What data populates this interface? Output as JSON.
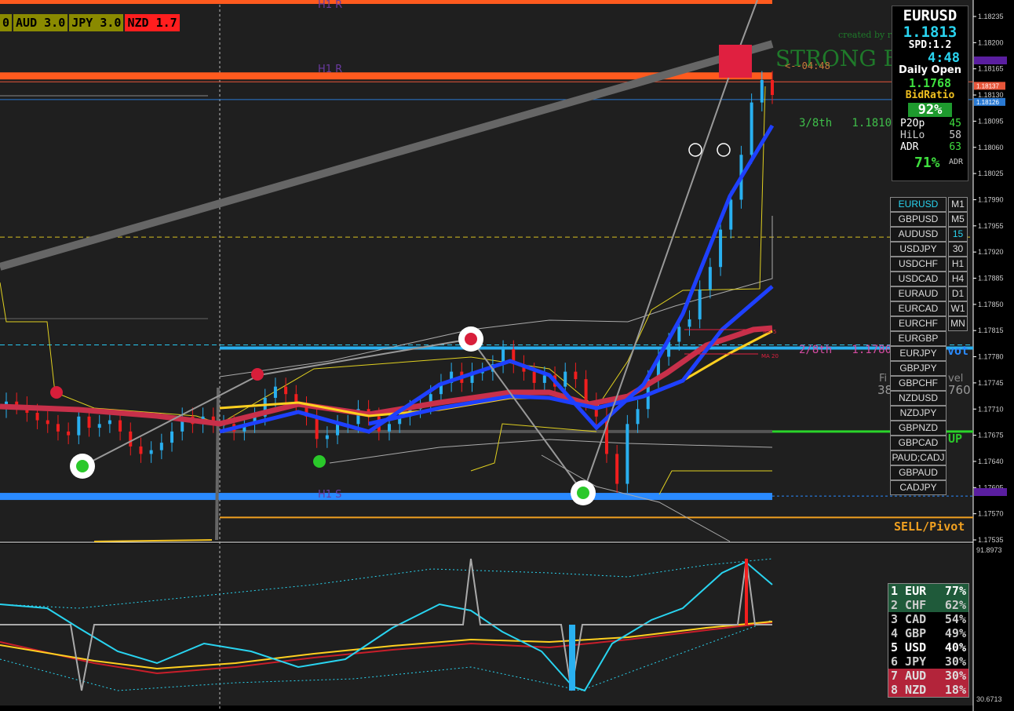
{
  "strength_bar": [
    {
      "label": "0",
      "bg": "#8a8a00",
      "fg": "#000"
    },
    {
      "label": "AUD 3.0",
      "bg": "#8a8a00",
      "fg": "#000"
    },
    {
      "label": "JPY 3.0",
      "bg": "#8a8a00",
      "fg": "#000"
    },
    {
      "label": "NZD 1.7",
      "bg": "#ff1e1e",
      "fg": "#000"
    }
  ],
  "info_panel": {
    "symbol": "EURUSD",
    "price": "1.1813",
    "spread": "SPD:1.2",
    "timer": "4:48",
    "daily_open_label": "Daily Open",
    "daily_open": "1.1768",
    "bid_ratio_label": "BidRatio",
    "bid_ratio": "92%",
    "p2op_label": "P2Op",
    "p2op": "45",
    "hilo_label": "HiLo",
    "hilo": "58",
    "adr_label": "ADR",
    "adr": "63",
    "adr_pct": "71%",
    "adr_pct_label": "ADR"
  },
  "symbols": [
    {
      "sym": "EURUSD",
      "tf": "M1",
      "active": true
    },
    {
      "sym": "GBPUSD",
      "tf": "M5"
    },
    {
      "sym": "AUDUSD",
      "tf": "15",
      "tf_active": true
    },
    {
      "sym": "USDJPY",
      "tf": "30"
    },
    {
      "sym": "USDCHF",
      "tf": "H1"
    },
    {
      "sym": "USDCAD",
      "tf": "H4"
    },
    {
      "sym": "EURAUD",
      "tf": "D1"
    },
    {
      "sym": "EURCAD",
      "tf": "W1"
    },
    {
      "sym": "EURCHF",
      "tf": "MN"
    },
    {
      "sym": "EURGBP",
      "tf": ""
    },
    {
      "sym": "EURJPY",
      "tf": ""
    },
    {
      "sym": "GBPJPY",
      "tf": ""
    },
    {
      "sym": "GBPCHF",
      "tf": ""
    },
    {
      "sym": "NZDUSD",
      "tf": ""
    },
    {
      "sym": "NZDJPY",
      "tf": ""
    },
    {
      "sym": "GBPNZD",
      "tf": ""
    },
    {
      "sym": "GBPCAD",
      "tf": ""
    },
    {
      "sym": "PAUD;CADJ",
      "tf": ""
    },
    {
      "sym": "GBPAUD",
      "tf": ""
    },
    {
      "sym": "CADJPY",
      "tf": ""
    }
  ],
  "ranking": [
    {
      "rank": "1",
      "cur": "EUR",
      "pct": "77%",
      "bg": "#1f5a3a",
      "fg": "#fff"
    },
    {
      "rank": "2",
      "cur": "CHF",
      "pct": "62%",
      "bg": "#1f5a3a",
      "fg": "#ccc"
    },
    {
      "rank": "3",
      "cur": "CAD",
      "pct": "54%",
      "bg": "#000",
      "fg": "#ccc"
    },
    {
      "rank": "4",
      "cur": "GBP",
      "pct": "49%",
      "bg": "#000",
      "fg": "#ccc"
    },
    {
      "rank": "5",
      "cur": "USD",
      "pct": "40%",
      "bg": "#000",
      "fg": "#fff"
    },
    {
      "rank": "6",
      "cur": "JPY",
      "pct": "30%",
      "bg": "#000",
      "fg": "#ccc"
    },
    {
      "rank": "7",
      "cur": "AUD",
      "pct": "30%",
      "bg": "#b3243a",
      "fg": "#ddd"
    },
    {
      "rank": "8",
      "cur": "NZD",
      "pct": "18%",
      "bg": "#b3243a",
      "fg": "#ddd"
    }
  ],
  "labels": {
    "strong": "STRONG B",
    "created_by": "created by re",
    "countdown": "<--04:48",
    "eighth_3": "3/8th   1.1810",
    "eighth_2": "2/8th   1.1780",
    "pivot_suffix": "vot",
    "sell_pivot": "SELL/Pivot",
    "up": "UP",
    "h1r": "H1 R",
    "h1s": "H1 S",
    "fib_a": "Fi",
    "fib_b": "vel",
    "fib_c": "38",
    "fib_d": "760",
    "ma5": "MA 5",
    "ma20": "MA 20"
  },
  "chart_data": {
    "type": "candlestick",
    "symbol": "EURUSD",
    "y_range": [
      1.17535,
      1.18235
    ],
    "price_axis_ticks": [
      "1.18235",
      "1.18200",
      "1.18165",
      "1.18130",
      "1.18095",
      "1.18060",
      "1.18025",
      "1.17990",
      "1.17955",
      "1.17920",
      "1.17885",
      "1.17850",
      "1.17815",
      "1.17780",
      "1.17745",
      "1.17710",
      "1.17675",
      "1.17640",
      "1.17605",
      "1.17570",
      "1.17535"
    ],
    "price_markers": [
      {
        "value": "1.18137",
        "color": "#e8563a"
      },
      {
        "value": "1.18126",
        "color": "#2a7ad4"
      }
    ],
    "levels": {
      "h1r": 1.18195,
      "daily_high": 1.18155,
      "eighth_3": 1.181,
      "eighth_2": 1.178,
      "daily_open": 1.1768,
      "h1s": 1.176,
      "sell_pivot": 1.17565
    },
    "closes": [
      1.1772,
      1.17715,
      1.17705,
      1.17695,
      1.1769,
      1.1768,
      1.17675,
      1.177,
      1.17685,
      1.1769,
      1.17695,
      1.1768,
      1.1766,
      1.1765,
      1.17655,
      1.17665,
      1.1768,
      1.177,
      1.1769,
      1.177,
      1.1769,
      1.1769,
      1.1768,
      1.1769,
      1.177,
      1.17725,
      1.1774,
      1.1773,
      1.17715,
      1.177,
      1.1767,
      1.17675,
      1.1769,
      1.1769,
      1.1771,
      1.177,
      1.1768,
      1.1769,
      1.177,
      1.1771,
      1.17715,
      1.1773,
      1.17745,
      1.1776,
      1.17745,
      1.1776,
      1.1776,
      1.1777,
      1.1779,
      1.1777,
      1.1776,
      1.17745,
      1.17755,
      1.1774,
      1.1776,
      1.1775,
      1.1772,
      1.177,
      1.1765,
      1.1761,
      1.1769,
      1.1771,
      1.1775,
      1.1778,
      1.178,
      1.1782,
      1.1783,
      1.1787,
      1.179,
      1.1795,
      1.1799,
      1.1805,
      1.1812,
      1.1815,
      1.1813
    ],
    "opens": [
      1.1771,
      1.1772,
      1.17715,
      1.17705,
      1.17695,
      1.1769,
      1.1768,
      1.17675,
      1.177,
      1.17685,
      1.1769,
      1.17695,
      1.1768,
      1.1766,
      1.1765,
      1.17655,
      1.17665,
      1.1768,
      1.177,
      1.1769,
      1.177,
      1.1769,
      1.1769,
      1.1768,
      1.1769,
      1.177,
      1.17725,
      1.1774,
      1.1773,
      1.17715,
      1.177,
      1.1767,
      1.17675,
      1.1769,
      1.1769,
      1.1771,
      1.177,
      1.1768,
      1.1769,
      1.177,
      1.1771,
      1.17715,
      1.1773,
      1.17745,
      1.1776,
      1.17745,
      1.1776,
      1.1776,
      1.1777,
      1.1779,
      1.1777,
      1.1776,
      1.17745,
      1.17755,
      1.1774,
      1.1776,
      1.1775,
      1.1772,
      1.177,
      1.1765,
      1.1761,
      1.1769,
      1.1771,
      1.1775,
      1.1778,
      1.178,
      1.1782,
      1.1783,
      1.1787,
      1.179,
      1.1795,
      1.1799,
      1.1805,
      1.1812,
      1.1815
    ],
    "oscillator_range": [
      30.6713,
      91.8973
    ],
    "oscillator_ticks": [
      "91.8973",
      "30.6713"
    ]
  }
}
